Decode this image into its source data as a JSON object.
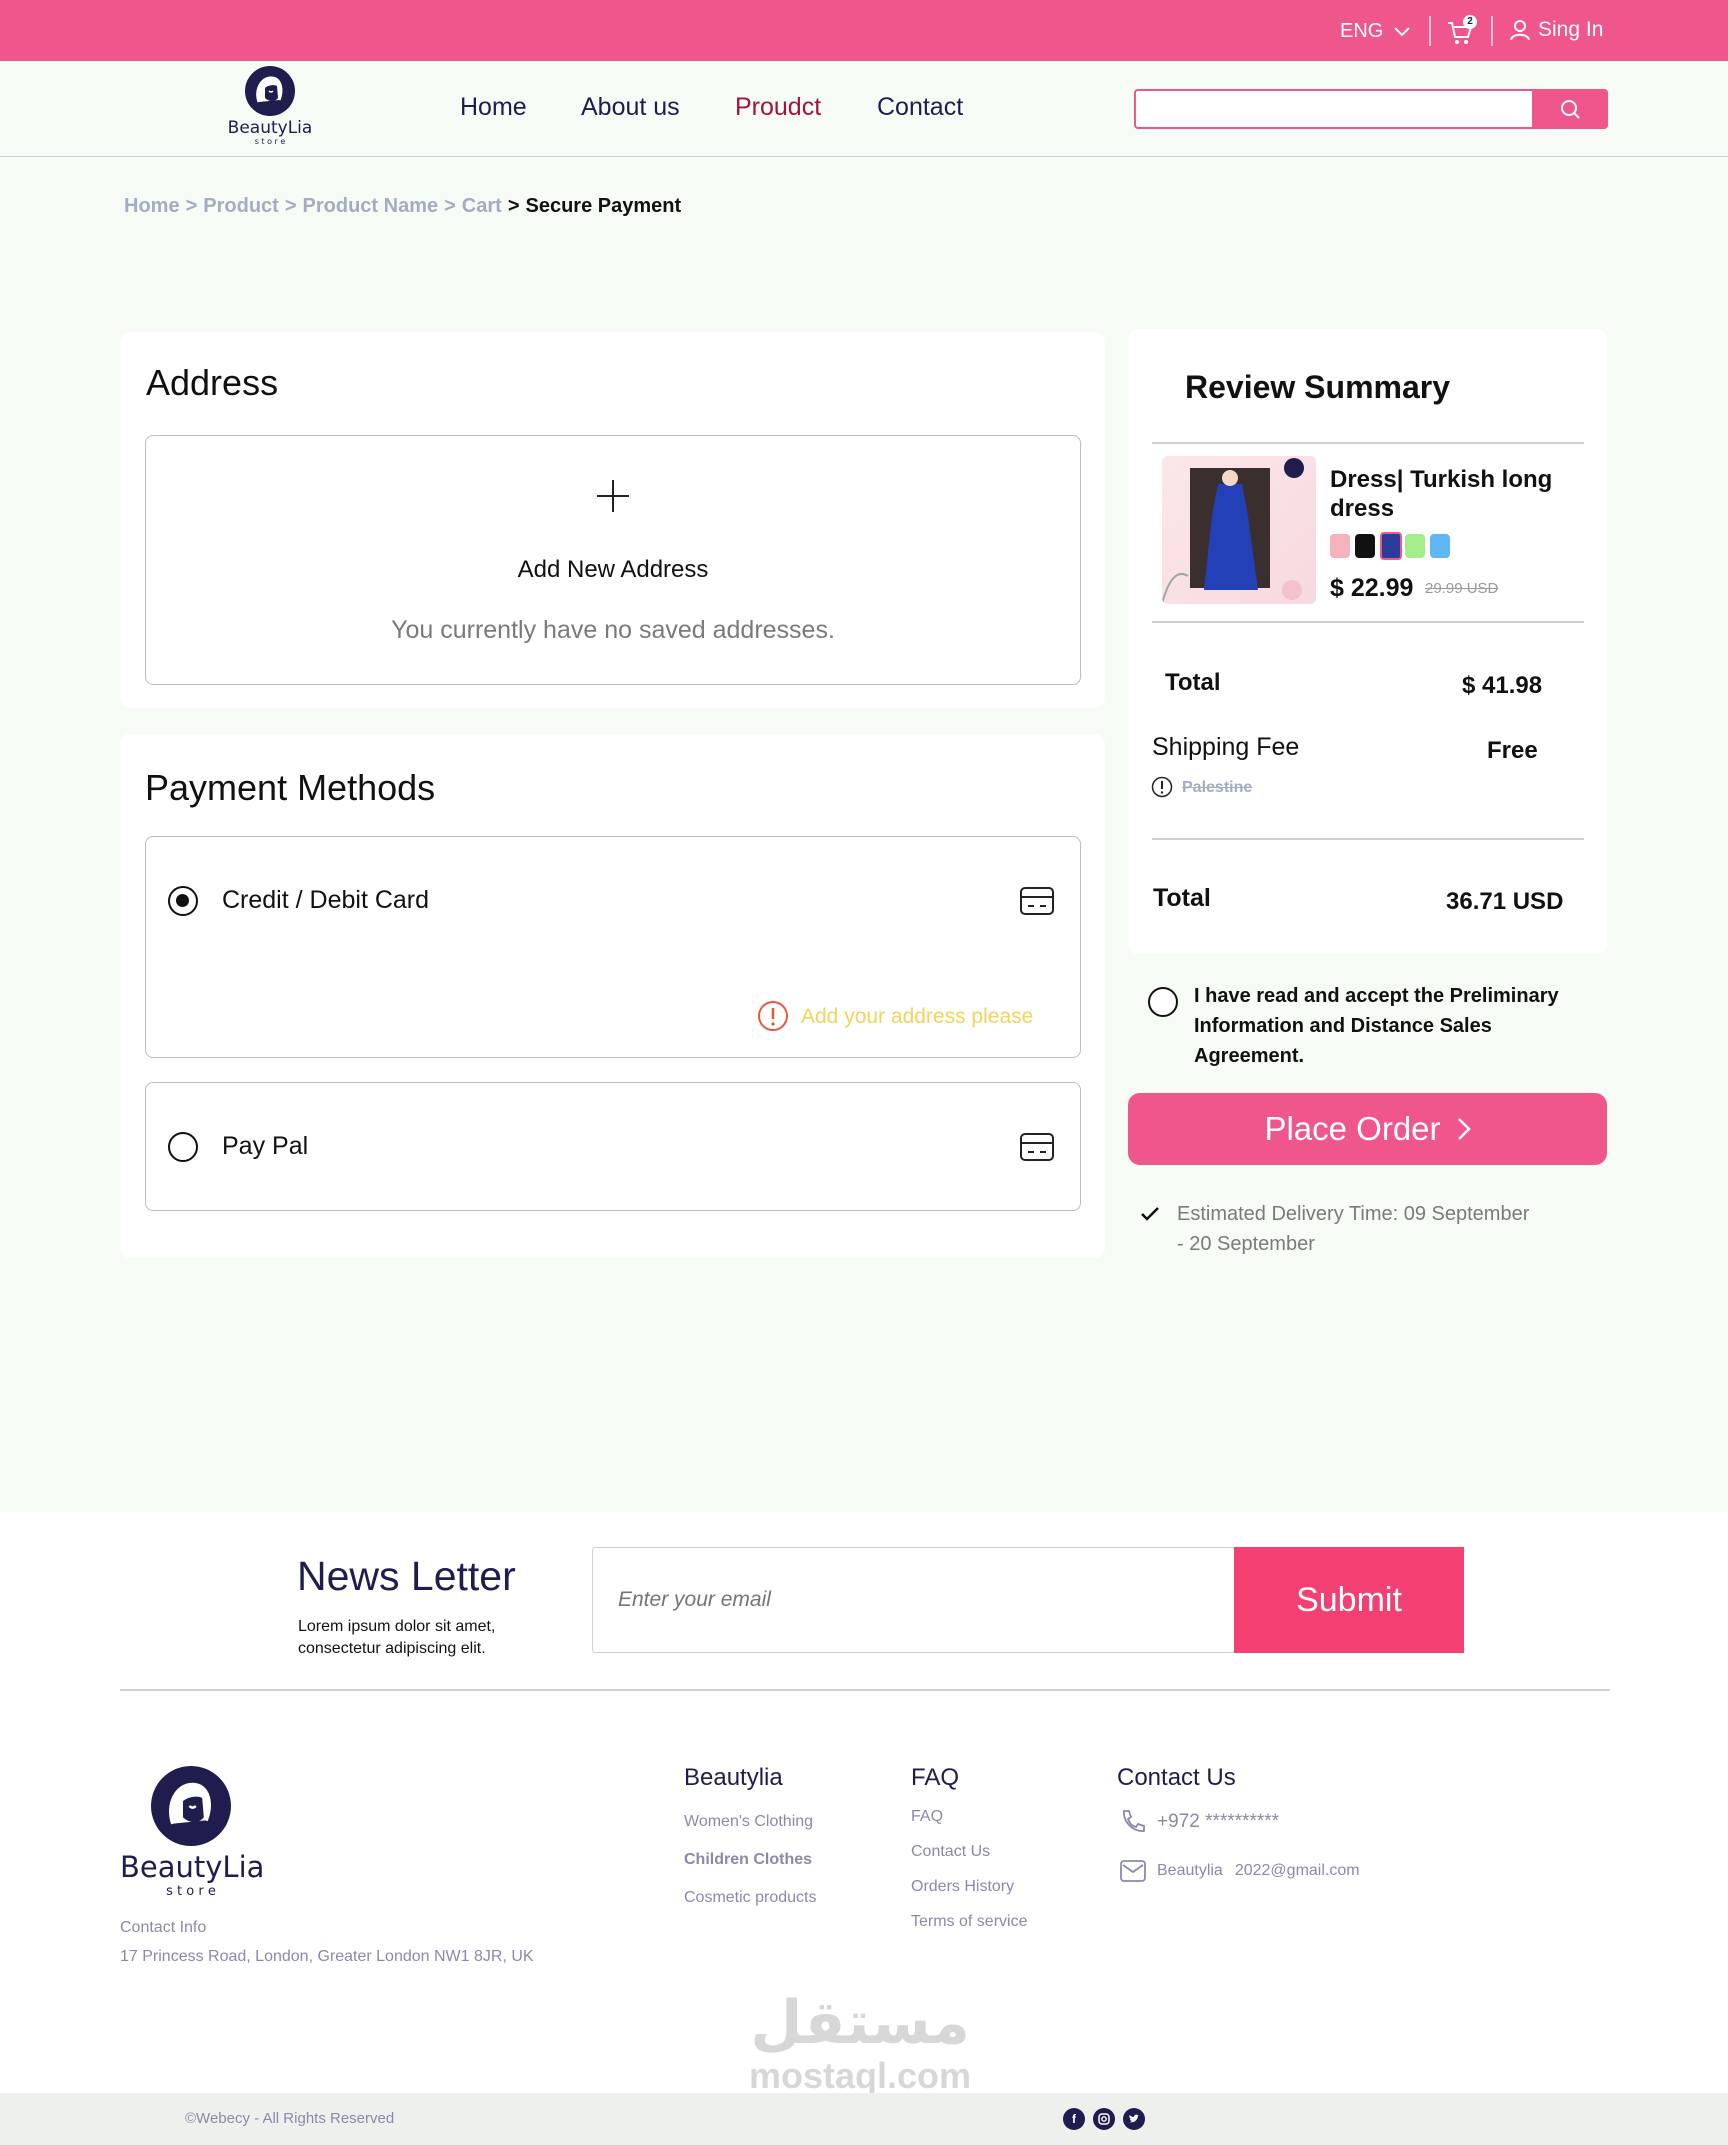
{
  "header": {
    "language": "ENG",
    "cart_count": "2",
    "signin_label": "Sing In"
  },
  "brand": {
    "name": "BeautyLia",
    "tagline": "s t o r e"
  },
  "nav": {
    "items": [
      "Home",
      "About us",
      "Proudct",
      "Contact"
    ],
    "active_index": 2,
    "search_placeholder": ""
  },
  "breadcrumb": [
    "Home",
    "Product",
    "Product Name",
    "Cart",
    "Secure Payment"
  ],
  "breadcrumb_separator": ">",
  "address": {
    "title": "Address",
    "add_label": "Add New Address",
    "empty_message": "You currently have no saved addresses."
  },
  "payment": {
    "title": "Payment Methods",
    "methods": [
      {
        "label": "Credit / Debit Card",
        "selected": true
      },
      {
        "label": "Pay Pal",
        "selected": false
      }
    ],
    "warning": "Add your address please"
  },
  "summary": {
    "title": "Review Summary",
    "product_name_line1": "Dress| Turkish long",
    "product_name_line2": "dress",
    "swatches": [
      "#f4b3bd",
      "#111111",
      "#2a3c9a",
      "#a3ee8a",
      "#5fb8f4"
    ],
    "price": "$ 22.99",
    "old_price": "29.99 USD",
    "total_label": "Total",
    "total_value": "$ 41.98",
    "shipping_label": "Shipping Fee",
    "shipping_value": "Free",
    "shipping_location": "Palestine",
    "grand_total_label": "Total",
    "grand_total_value": "36.71 USD"
  },
  "agreement": {
    "line1": "I have read and accept the Preliminary",
    "line2": "Information and Distance Sales",
    "line3": "Agreement."
  },
  "place_order_label": "Place Order",
  "delivery": {
    "line1": "Estimated Delivery Time: 09 September",
    "line2": "- 20 September"
  },
  "newsletter": {
    "title": "News Letter",
    "desc_line1": "Lorem ipsum dolor sit amet,",
    "desc_line2": "consectetur adipiscing elit.",
    "placeholder": "Enter your email",
    "submit_label": "Submit"
  },
  "footer": {
    "contact_info_label": "Contact Info",
    "address": "17 Princess Road, London, Greater London NW1 8JR, UK",
    "col1": {
      "title": "Beautylia",
      "links": [
        "Women's Clothing",
        "Children Clothes",
        "Cosmetic products"
      ]
    },
    "col2": {
      "title": "FAQ",
      "links": [
        "FAQ",
        "Contact Us",
        "Orders History",
        "Terms of service"
      ]
    },
    "col3": {
      "title": "Contact Us",
      "phone": "+972 **********",
      "email_name": "Beautylia",
      "email": "2022@gmail.com"
    },
    "copyright": "©Webecy - All Rights Reserved"
  },
  "watermark": {
    "arabic": "مستقل",
    "latin": "mostaql.com"
  },
  "colors": {
    "brand_pink": "#ee568c",
    "brand_navy": "#1f1c4e",
    "active_nav": "#a0153e",
    "warning_yellow": "#f2d45c",
    "warning_red": "#e8563d"
  }
}
